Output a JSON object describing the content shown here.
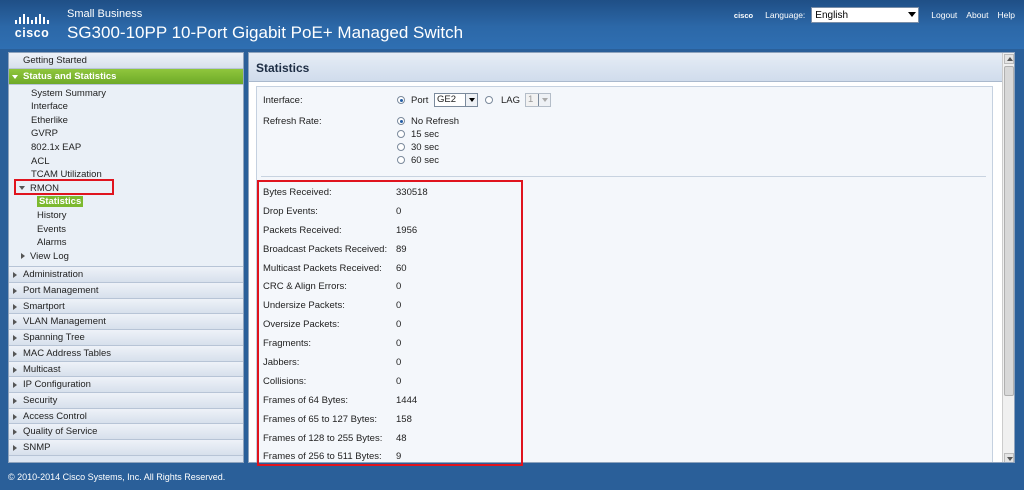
{
  "header": {
    "brand_sub": "Small Business",
    "title": "SG300-10PP 10-Port Gigabit PoE+ Managed Switch",
    "logo_text": "cisco",
    "cisco_small": "cisco",
    "language_label": "Language:",
    "language_value": "English",
    "links": [
      "Logout",
      "About",
      "Help"
    ]
  },
  "sidebar": {
    "getting_started": "Getting Started",
    "section": "Status and Statistics",
    "items": [
      "System Summary",
      "Interface",
      "Etherlike",
      "GVRP",
      "802.1x EAP",
      "ACL",
      "TCAM Utilization"
    ],
    "rmon": "RMON",
    "rmon_items": [
      "Statistics",
      "History",
      "Events",
      "Alarms"
    ],
    "view_log": "View Log",
    "sections": [
      "Administration",
      "Port Management",
      "Smartport",
      "VLAN Management",
      "Spanning Tree",
      "MAC Address Tables",
      "Multicast",
      "IP Configuration",
      "Security",
      "Access Control",
      "Quality of Service",
      "SNMP"
    ]
  },
  "main": {
    "title": "Statistics",
    "interface_label": "Interface:",
    "port_label": "Port",
    "port_value": "GE2",
    "lag_label": "LAG",
    "lag_value": "1",
    "refresh_label": "Refresh Rate:",
    "refresh_options": [
      "No Refresh",
      "15 sec",
      "30 sec",
      "60 sec"
    ],
    "stats": [
      {
        "label": "Bytes Received:",
        "value": "330518"
      },
      {
        "label": "Drop Events:",
        "value": "0"
      },
      {
        "label": "Packets Received:",
        "value": "1956"
      },
      {
        "label": "Broadcast Packets Received:",
        "value": "89"
      },
      {
        "label": "Multicast Packets Received:",
        "value": "60"
      },
      {
        "label": "CRC & Align Errors:",
        "value": "0"
      },
      {
        "label": "Undersize Packets:",
        "value": "0"
      },
      {
        "label": "Oversize Packets:",
        "value": "0"
      },
      {
        "label": "Fragments:",
        "value": "0"
      },
      {
        "label": "Jabbers:",
        "value": "0"
      },
      {
        "label": "Collisions:",
        "value": "0"
      },
      {
        "label": "Frames of 64 Bytes:",
        "value": "1444"
      },
      {
        "label": "Frames of 65 to 127 Bytes:",
        "value": "158"
      },
      {
        "label": "Frames of 128 to 255 Bytes:",
        "value": "48"
      },
      {
        "label": "Frames of 256 to 511 Bytes:",
        "value": "9"
      }
    ]
  },
  "footer": {
    "copyright": "© 2010-2014 Cisco Systems, Inc. All Rights Reserved."
  }
}
